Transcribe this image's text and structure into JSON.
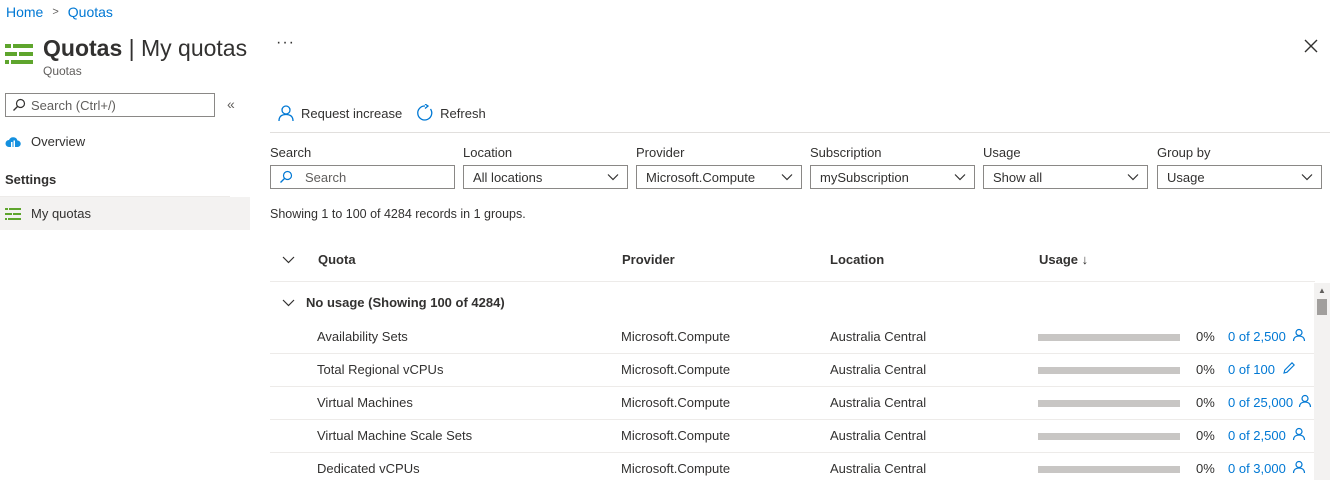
{
  "breadcrumb": {
    "home": "Home",
    "current": "Quotas"
  },
  "header": {
    "title_bold": "Quotas",
    "title_rest": " | My quotas",
    "subtitle": "Quotas",
    "more": "···"
  },
  "nav": {
    "search_placeholder": "Search (Ctrl+/)",
    "collapse": "«",
    "overview": "Overview",
    "section": "Settings",
    "my_quotas": "My quotas"
  },
  "toolbar": {
    "request_increase": "Request increase",
    "refresh": "Refresh"
  },
  "filters": {
    "search_label": "Search",
    "search_placeholder": "Search",
    "location_label": "Location",
    "location_value": "All locations",
    "provider_label": "Provider",
    "provider_value": "Microsoft.Compute",
    "subscription_label": "Subscription",
    "subscription_value": "mySubscription",
    "usage_label": "Usage",
    "usage_value": "Show all",
    "groupby_label": "Group by",
    "groupby_value": "Usage"
  },
  "records_text": "Showing 1 to 100 of 4284 records in 1 groups.",
  "table": {
    "columns": {
      "quota": "Quota",
      "provider": "Provider",
      "location": "Location",
      "usage": "Usage ↓"
    },
    "group_label": "No usage (Showing 100 of 4284)",
    "rows": [
      {
        "quota": "Availability Sets",
        "provider": "Microsoft.Compute",
        "location": "Australia Central",
        "usage_fraction": 0,
        "percent": "0%",
        "limit": "0 of 2,500",
        "action_icon": "person-icon"
      },
      {
        "quota": "Total Regional vCPUs",
        "provider": "Microsoft.Compute",
        "location": "Australia Central",
        "usage_fraction": 0,
        "percent": "0%",
        "limit": "0 of 100",
        "action_icon": "pencil-icon"
      },
      {
        "quota": "Virtual Machines",
        "provider": "Microsoft.Compute",
        "location": "Australia Central",
        "usage_fraction": 0,
        "percent": "0%",
        "limit": "0 of 25,000",
        "action_icon": "person-icon"
      },
      {
        "quota": "Virtual Machine Scale Sets",
        "provider": "Microsoft.Compute",
        "location": "Australia Central",
        "usage_fraction": 0,
        "percent": "0%",
        "limit": "0 of 2,500",
        "action_icon": "person-icon"
      },
      {
        "quota": "Dedicated vCPUs",
        "provider": "Microsoft.Compute",
        "location": "Australia Central",
        "usage_fraction": 0,
        "percent": "0%",
        "limit": "0 of 3,000",
        "action_icon": "person-icon"
      }
    ]
  },
  "colors": {
    "accent": "#0078d4",
    "quota_green": "#5ea52d",
    "bar_track": "#c8c6c4"
  }
}
